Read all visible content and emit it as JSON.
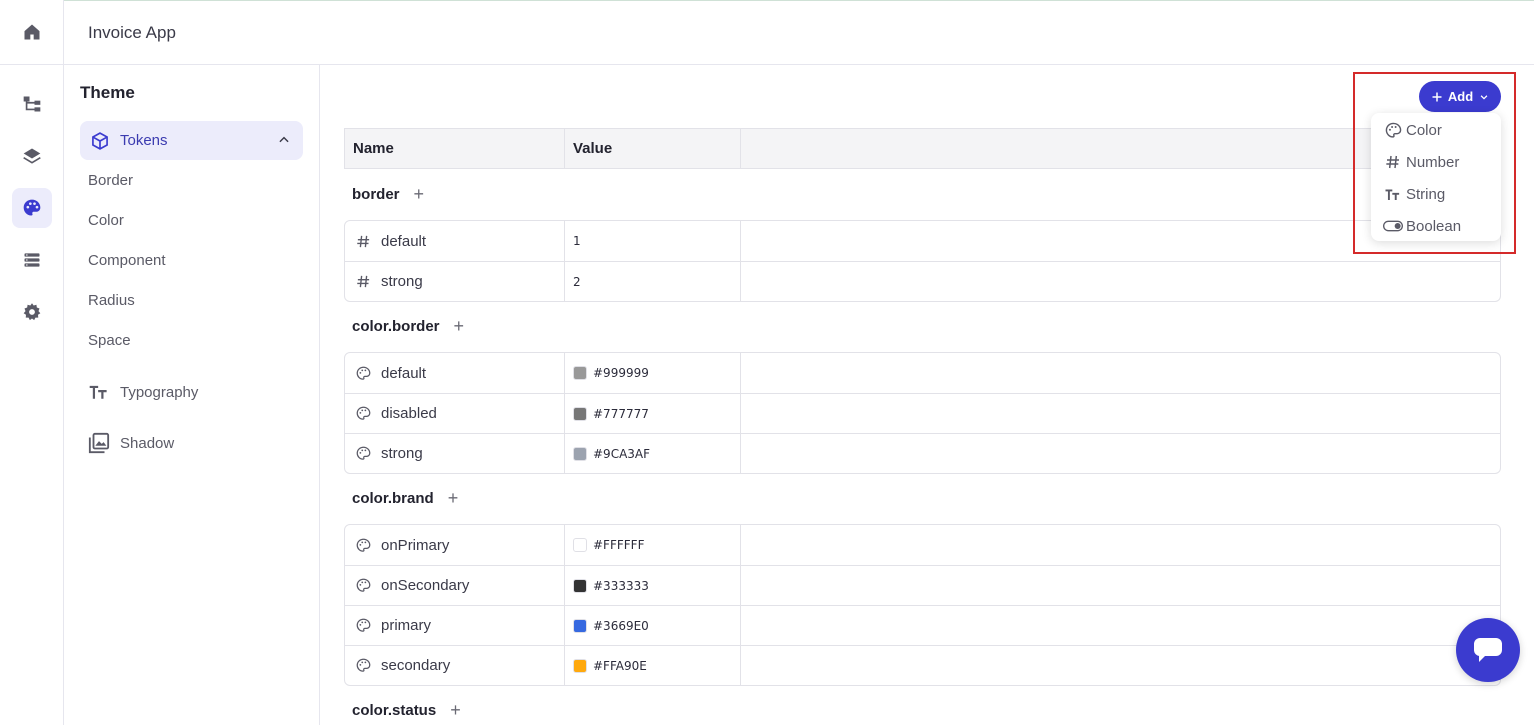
{
  "app": {
    "title": "Invoice App"
  },
  "rail": {
    "items": [
      {
        "name": "home-icon",
        "active": false
      },
      {
        "name": "hierarchy-icon",
        "active": false
      },
      {
        "name": "layers-icon",
        "active": false
      },
      {
        "name": "palette-icon",
        "active": true
      },
      {
        "name": "list-icon",
        "active": false
      },
      {
        "name": "gear-icon",
        "active": false
      }
    ]
  },
  "sidebar": {
    "title": "Theme",
    "group": {
      "label": "Tokens",
      "icon": "cube-icon",
      "expanded": true
    },
    "items": [
      "Border",
      "Color",
      "Component",
      "Radius",
      "Space"
    ],
    "categories": [
      {
        "label": "Typography",
        "icon": "typography-icon"
      },
      {
        "label": "Shadow",
        "icon": "image-stack-icon"
      }
    ]
  },
  "table": {
    "headers": {
      "name": "Name",
      "value": "Value"
    },
    "groups": [
      {
        "title": "border",
        "rows": [
          {
            "icon": "hash-icon",
            "name": "default",
            "value": "1"
          },
          {
            "icon": "hash-icon",
            "name": "strong",
            "value": "2"
          }
        ]
      },
      {
        "title": "color.border",
        "rows": [
          {
            "icon": "palette-icon",
            "name": "default",
            "value": "#999999",
            "swatch": "#999999"
          },
          {
            "icon": "palette-icon",
            "name": "disabled",
            "value": "#777777",
            "swatch": "#777777"
          },
          {
            "icon": "palette-icon",
            "name": "strong",
            "value": "#9CA3AF",
            "swatch": "#9CA3AF"
          }
        ]
      },
      {
        "title": "color.brand",
        "rows": [
          {
            "icon": "palette-icon",
            "name": "onPrimary",
            "value": "#FFFFFF",
            "swatch": "#FFFFFF"
          },
          {
            "icon": "palette-icon",
            "name": "onSecondary",
            "value": "#333333",
            "swatch": "#333333"
          },
          {
            "icon": "palette-icon",
            "name": "primary",
            "value": "#3669E0",
            "swatch": "#3669E0"
          },
          {
            "icon": "palette-icon",
            "name": "secondary",
            "value": "#FFA90E",
            "swatch": "#FFA90E"
          }
        ]
      },
      {
        "title": "color.status",
        "rows": []
      }
    ]
  },
  "add_menu": {
    "button_label": "Add",
    "options": [
      {
        "label": "Color",
        "icon": "palette-icon"
      },
      {
        "label": "Number",
        "icon": "hash-icon"
      },
      {
        "label": "String",
        "icon": "typography-icon"
      },
      {
        "label": "Boolean",
        "icon": "toggle-icon"
      }
    ]
  },
  "colors": {
    "accent": "#3B3BCF",
    "accent_light": "#ECECFB",
    "highlight": "#D42A2A"
  }
}
